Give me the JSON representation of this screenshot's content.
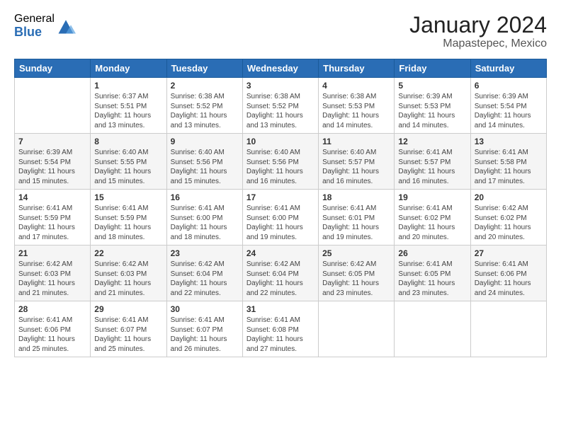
{
  "logo": {
    "general": "General",
    "blue": "Blue"
  },
  "title": "January 2024",
  "location": "Mapastepec, Mexico",
  "days_of_week": [
    "Sunday",
    "Monday",
    "Tuesday",
    "Wednesday",
    "Thursday",
    "Friday",
    "Saturday"
  ],
  "weeks": [
    [
      {
        "day": "",
        "sunrise": "",
        "sunset": "",
        "daylight": ""
      },
      {
        "day": "1",
        "sunrise": "Sunrise: 6:37 AM",
        "sunset": "Sunset: 5:51 PM",
        "daylight": "Daylight: 11 hours and 13 minutes."
      },
      {
        "day": "2",
        "sunrise": "Sunrise: 6:38 AM",
        "sunset": "Sunset: 5:52 PM",
        "daylight": "Daylight: 11 hours and 13 minutes."
      },
      {
        "day": "3",
        "sunrise": "Sunrise: 6:38 AM",
        "sunset": "Sunset: 5:52 PM",
        "daylight": "Daylight: 11 hours and 13 minutes."
      },
      {
        "day": "4",
        "sunrise": "Sunrise: 6:38 AM",
        "sunset": "Sunset: 5:53 PM",
        "daylight": "Daylight: 11 hours and 14 minutes."
      },
      {
        "day": "5",
        "sunrise": "Sunrise: 6:39 AM",
        "sunset": "Sunset: 5:53 PM",
        "daylight": "Daylight: 11 hours and 14 minutes."
      },
      {
        "day": "6",
        "sunrise": "Sunrise: 6:39 AM",
        "sunset": "Sunset: 5:54 PM",
        "daylight": "Daylight: 11 hours and 14 minutes."
      }
    ],
    [
      {
        "day": "7",
        "sunrise": "Sunrise: 6:39 AM",
        "sunset": "Sunset: 5:54 PM",
        "daylight": "Daylight: 11 hours and 15 minutes."
      },
      {
        "day": "8",
        "sunrise": "Sunrise: 6:40 AM",
        "sunset": "Sunset: 5:55 PM",
        "daylight": "Daylight: 11 hours and 15 minutes."
      },
      {
        "day": "9",
        "sunrise": "Sunrise: 6:40 AM",
        "sunset": "Sunset: 5:56 PM",
        "daylight": "Daylight: 11 hours and 15 minutes."
      },
      {
        "day": "10",
        "sunrise": "Sunrise: 6:40 AM",
        "sunset": "Sunset: 5:56 PM",
        "daylight": "Daylight: 11 hours and 16 minutes."
      },
      {
        "day": "11",
        "sunrise": "Sunrise: 6:40 AM",
        "sunset": "Sunset: 5:57 PM",
        "daylight": "Daylight: 11 hours and 16 minutes."
      },
      {
        "day": "12",
        "sunrise": "Sunrise: 6:41 AM",
        "sunset": "Sunset: 5:57 PM",
        "daylight": "Daylight: 11 hours and 16 minutes."
      },
      {
        "day": "13",
        "sunrise": "Sunrise: 6:41 AM",
        "sunset": "Sunset: 5:58 PM",
        "daylight": "Daylight: 11 hours and 17 minutes."
      }
    ],
    [
      {
        "day": "14",
        "sunrise": "Sunrise: 6:41 AM",
        "sunset": "Sunset: 5:59 PM",
        "daylight": "Daylight: 11 hours and 17 minutes."
      },
      {
        "day": "15",
        "sunrise": "Sunrise: 6:41 AM",
        "sunset": "Sunset: 5:59 PM",
        "daylight": "Daylight: 11 hours and 18 minutes."
      },
      {
        "day": "16",
        "sunrise": "Sunrise: 6:41 AM",
        "sunset": "Sunset: 6:00 PM",
        "daylight": "Daylight: 11 hours and 18 minutes."
      },
      {
        "day": "17",
        "sunrise": "Sunrise: 6:41 AM",
        "sunset": "Sunset: 6:00 PM",
        "daylight": "Daylight: 11 hours and 19 minutes."
      },
      {
        "day": "18",
        "sunrise": "Sunrise: 6:41 AM",
        "sunset": "Sunset: 6:01 PM",
        "daylight": "Daylight: 11 hours and 19 minutes."
      },
      {
        "day": "19",
        "sunrise": "Sunrise: 6:41 AM",
        "sunset": "Sunset: 6:02 PM",
        "daylight": "Daylight: 11 hours and 20 minutes."
      },
      {
        "day": "20",
        "sunrise": "Sunrise: 6:42 AM",
        "sunset": "Sunset: 6:02 PM",
        "daylight": "Daylight: 11 hours and 20 minutes."
      }
    ],
    [
      {
        "day": "21",
        "sunrise": "Sunrise: 6:42 AM",
        "sunset": "Sunset: 6:03 PM",
        "daylight": "Daylight: 11 hours and 21 minutes."
      },
      {
        "day": "22",
        "sunrise": "Sunrise: 6:42 AM",
        "sunset": "Sunset: 6:03 PM",
        "daylight": "Daylight: 11 hours and 21 minutes."
      },
      {
        "day": "23",
        "sunrise": "Sunrise: 6:42 AM",
        "sunset": "Sunset: 6:04 PM",
        "daylight": "Daylight: 11 hours and 22 minutes."
      },
      {
        "day": "24",
        "sunrise": "Sunrise: 6:42 AM",
        "sunset": "Sunset: 6:04 PM",
        "daylight": "Daylight: 11 hours and 22 minutes."
      },
      {
        "day": "25",
        "sunrise": "Sunrise: 6:42 AM",
        "sunset": "Sunset: 6:05 PM",
        "daylight": "Daylight: 11 hours and 23 minutes."
      },
      {
        "day": "26",
        "sunrise": "Sunrise: 6:41 AM",
        "sunset": "Sunset: 6:05 PM",
        "daylight": "Daylight: 11 hours and 23 minutes."
      },
      {
        "day": "27",
        "sunrise": "Sunrise: 6:41 AM",
        "sunset": "Sunset: 6:06 PM",
        "daylight": "Daylight: 11 hours and 24 minutes."
      }
    ],
    [
      {
        "day": "28",
        "sunrise": "Sunrise: 6:41 AM",
        "sunset": "Sunset: 6:06 PM",
        "daylight": "Daylight: 11 hours and 25 minutes."
      },
      {
        "day": "29",
        "sunrise": "Sunrise: 6:41 AM",
        "sunset": "Sunset: 6:07 PM",
        "daylight": "Daylight: 11 hours and 25 minutes."
      },
      {
        "day": "30",
        "sunrise": "Sunrise: 6:41 AM",
        "sunset": "Sunset: 6:07 PM",
        "daylight": "Daylight: 11 hours and 26 minutes."
      },
      {
        "day": "31",
        "sunrise": "Sunrise: 6:41 AM",
        "sunset": "Sunset: 6:08 PM",
        "daylight": "Daylight: 11 hours and 27 minutes."
      },
      {
        "day": "",
        "sunrise": "",
        "sunset": "",
        "daylight": ""
      },
      {
        "day": "",
        "sunrise": "",
        "sunset": "",
        "daylight": ""
      },
      {
        "day": "",
        "sunrise": "",
        "sunset": "",
        "daylight": ""
      }
    ]
  ]
}
